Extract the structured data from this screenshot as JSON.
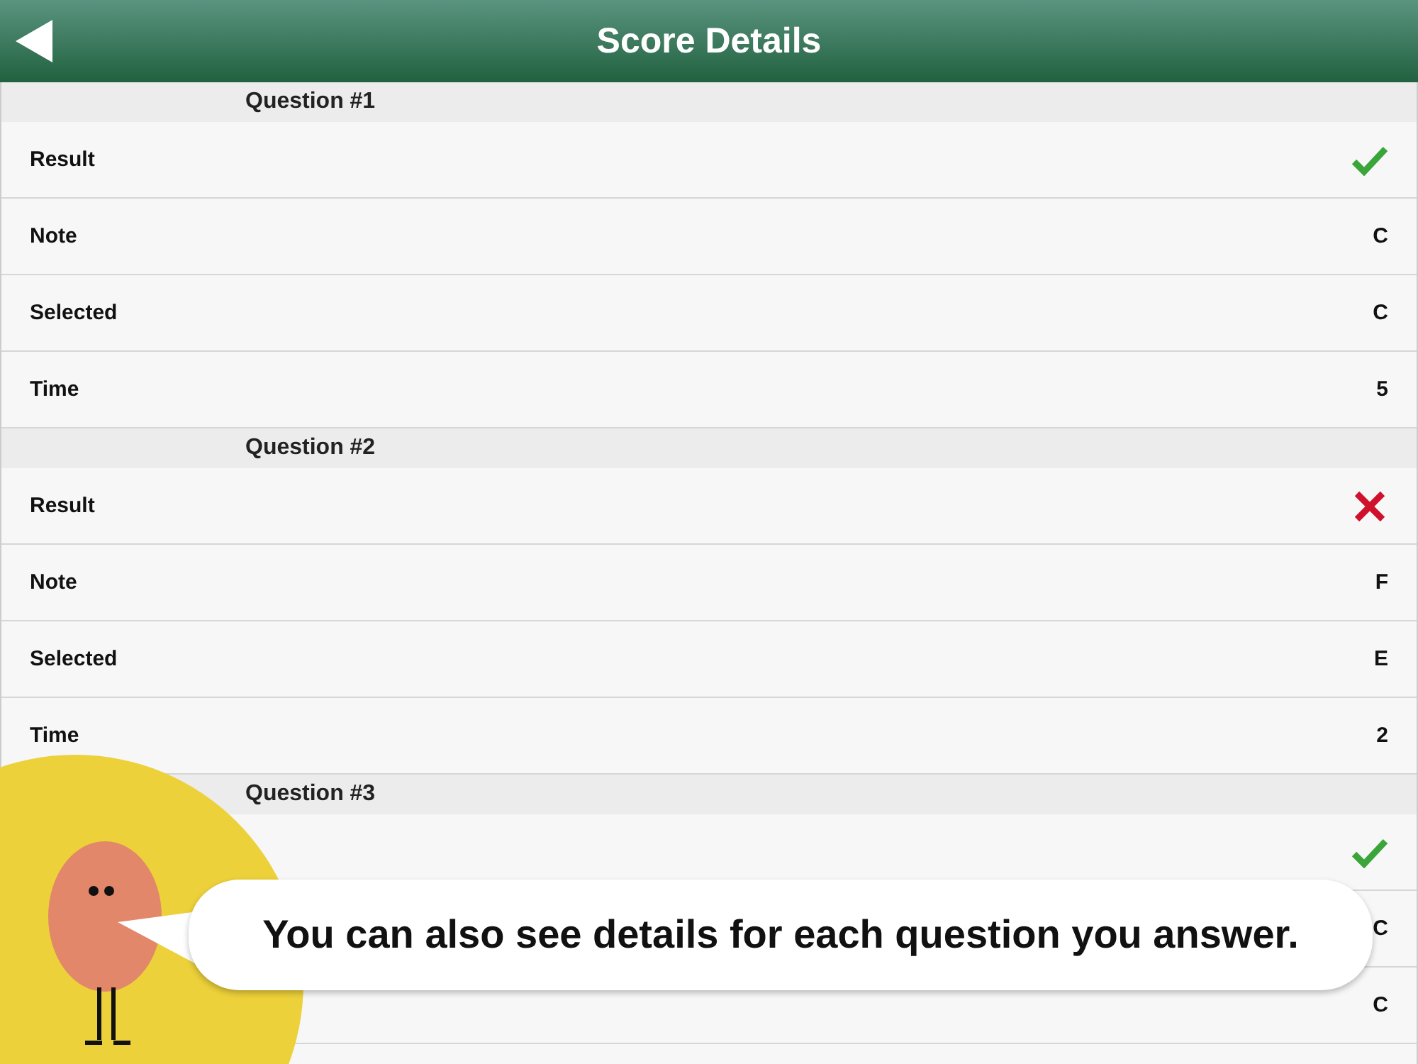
{
  "header": {
    "title": "Score Details"
  },
  "sections": [
    {
      "title": "Question #1",
      "rows": [
        {
          "kind": "result",
          "label": "Result",
          "correct": true
        },
        {
          "kind": "value",
          "label": "Note",
          "value": "C"
        },
        {
          "kind": "value",
          "label": "Selected",
          "value": "C"
        },
        {
          "kind": "value",
          "label": "Time",
          "value": "5"
        }
      ]
    },
    {
      "title": "Question #2",
      "rows": [
        {
          "kind": "result",
          "label": "Result",
          "correct": false
        },
        {
          "kind": "value",
          "label": "Note",
          "value": "F"
        },
        {
          "kind": "value",
          "label": "Selected",
          "value": "E"
        },
        {
          "kind": "value",
          "label": "Time",
          "value": "2"
        }
      ]
    },
    {
      "title": "Question #3",
      "rows": [
        {
          "kind": "result",
          "correct": true
        },
        {
          "kind": "value",
          "value": "C"
        },
        {
          "kind": "value",
          "value": "C"
        },
        {
          "kind": "value"
        }
      ]
    }
  ],
  "tip": {
    "text": "You can also see details for each question you answer."
  }
}
